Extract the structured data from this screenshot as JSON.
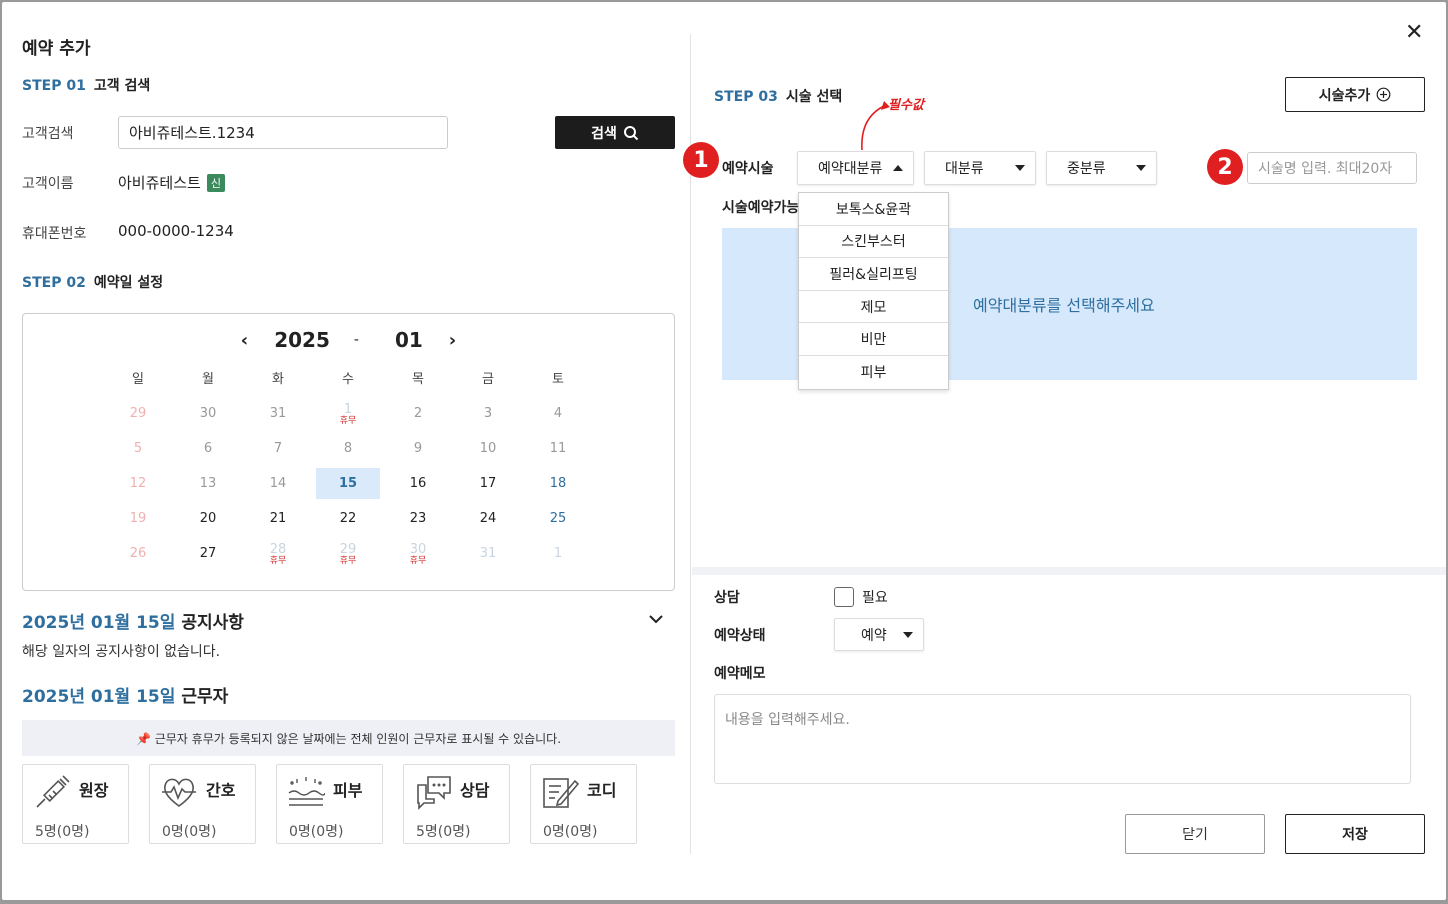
{
  "modal": {
    "title": "예약 추가",
    "close_glyph": "✕"
  },
  "step1": {
    "num": "STEP 01",
    "title": "고객 검색",
    "search_label": "고객검색",
    "search_value": "아비쥬테스트.1234",
    "search_button": "검색",
    "name_label": "고객이름",
    "name_value": "아비쥬테스트",
    "new_badge": "신",
    "phone_label": "휴대폰번호",
    "phone_value": "000-0000-1234"
  },
  "step2": {
    "num": "STEP 02",
    "title": "예약일 설정",
    "calendar": {
      "year": "2025",
      "sep": "-",
      "month": "01",
      "weekdays": [
        "일",
        "월",
        "화",
        "수",
        "목",
        "금",
        "토"
      ],
      "weeks": [
        [
          {
            "d": "29",
            "c": "sun-dim"
          },
          {
            "d": "30",
            "c": "dim"
          },
          {
            "d": "31",
            "c": "dim"
          },
          {
            "d": "1",
            "c": "sat-dim",
            "h": "휴무"
          },
          {
            "d": "2",
            "c": "dim"
          },
          {
            "d": "3",
            "c": "dim"
          },
          {
            "d": "4",
            "c": "dim"
          }
        ],
        [
          {
            "d": "5",
            "c": "sun-dim"
          },
          {
            "d": "6",
            "c": "dim"
          },
          {
            "d": "7",
            "c": "dim"
          },
          {
            "d": "8",
            "c": "dim"
          },
          {
            "d": "9",
            "c": "dim"
          },
          {
            "d": "10",
            "c": "dim"
          },
          {
            "d": "11",
            "c": "dim"
          }
        ],
        [
          {
            "d": "12",
            "c": "sun-dim"
          },
          {
            "d": "13",
            "c": "dim"
          },
          {
            "d": "14",
            "c": "dim"
          },
          {
            "d": "15",
            "c": "sel"
          },
          {
            "d": "16",
            "c": ""
          },
          {
            "d": "17",
            "c": ""
          },
          {
            "d": "18",
            "c": "sat"
          }
        ],
        [
          {
            "d": "19",
            "c": "sun-dim"
          },
          {
            "d": "20",
            "c": ""
          },
          {
            "d": "21",
            "c": ""
          },
          {
            "d": "22",
            "c": ""
          },
          {
            "d": "23",
            "c": ""
          },
          {
            "d": "24",
            "c": ""
          },
          {
            "d": "25",
            "c": "sat"
          }
        ],
        [
          {
            "d": "26",
            "c": "sun-dim"
          },
          {
            "d": "27",
            "c": ""
          },
          {
            "d": "28",
            "c": "sat-dim",
            "h": "휴무"
          },
          {
            "d": "29",
            "c": "sat-dim",
            "h": "휴무"
          },
          {
            "d": "30",
            "c": "sat-dim",
            "h": "휴무"
          },
          {
            "d": "31",
            "c": "sat-dim"
          },
          {
            "d": "1",
            "c": "sat-dim"
          }
        ]
      ]
    }
  },
  "notice": {
    "date": "2025년 01월 15일",
    "title": "공지사항",
    "empty": "해당 일자의 공지사항이 없습니다."
  },
  "staff_section": {
    "date": "2025년 01월 15일",
    "title": "근무자",
    "hint": "📌 근무자 휴무가 등록되지 않은 날짜에는 전체 인원이 근무자로 표시될 수 있습니다.",
    "cards": [
      {
        "name": "원장",
        "count": "5명(0명)",
        "icon": "syringe-icon"
      },
      {
        "name": "간호",
        "count": "0명(0명)",
        "icon": "heart-pulse-icon"
      },
      {
        "name": "피부",
        "count": "0명(0명)",
        "icon": "skin-icon"
      },
      {
        "name": "상담",
        "count": "5명(0명)",
        "icon": "chat-icon"
      },
      {
        "name": "코디",
        "count": "0명(0명)",
        "icon": "note-pen-icon"
      }
    ]
  },
  "step3": {
    "num": "STEP 03",
    "title": "시술 선택",
    "add_button": "시술추가",
    "required_note": "필수값",
    "procedure_label": "예약시술",
    "badge1": "1",
    "badge2": "2",
    "select_main": "예약대분류",
    "select_cat": "대분류",
    "select_sub": "중분류",
    "name_placeholder": "시술명 입력. 최대20자",
    "available_label": "시술예약가능",
    "dropdown_options": [
      "보톡스&윤곽",
      "스킨부스터",
      "필러&실리프팅",
      "제모",
      "비만",
      "피부"
    ],
    "empty_message": "예약대분류를 선택해주세요"
  },
  "bottom": {
    "consult_label": "상담",
    "consult_check": "필요",
    "status_label": "예약상태",
    "status_value": "예약",
    "memo_label": "예약메모",
    "memo_placeholder": "내용을 입력해주세요.",
    "close_button": "닫기",
    "save_button": "저장"
  }
}
